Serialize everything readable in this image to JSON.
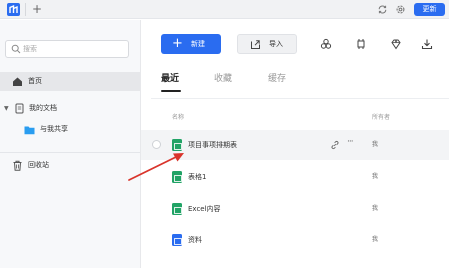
{
  "titlebar": {
    "new_tab": "+",
    "update_label": "更新",
    "icons": [
      "app-logo",
      "sync-icon",
      "settings-icon"
    ]
  },
  "sidebar": {
    "search_placeholder": "搜索",
    "items": [
      {
        "label": "首页",
        "icon": "home-icon",
        "active": true
      },
      {
        "label": "我的文档",
        "icon": "documents-icon",
        "expanded": true
      },
      {
        "label": "与我共享",
        "icon": "shared-folder-icon"
      },
      {
        "label": "回收站",
        "icon": "trash-icon"
      }
    ]
  },
  "toolbar": {
    "new_label": "新建",
    "import_label": "导入",
    "tools": [
      "templates-icon",
      "clip-icon",
      "diamond-icon",
      "download-icon"
    ]
  },
  "tabs": [
    {
      "label": "最近",
      "active": true
    },
    {
      "label": "收藏",
      "active": false
    },
    {
      "label": "缓存",
      "active": false
    }
  ],
  "table": {
    "headers": {
      "name": "名称",
      "owner": "所有者"
    },
    "rows": [
      {
        "name": "项目事项排期表",
        "owner": "我",
        "type": "sheet",
        "hover": true
      },
      {
        "name": "表格1",
        "owner": "我",
        "type": "sheet"
      },
      {
        "name": "Excel内容",
        "owner": "我",
        "type": "sheet"
      },
      {
        "name": "资料",
        "owner": "我",
        "type": "doc"
      }
    ]
  },
  "colors": {
    "accent": "#2a6cf0",
    "sheet": "#21a366",
    "annotation_arrow": "#d9342b"
  }
}
